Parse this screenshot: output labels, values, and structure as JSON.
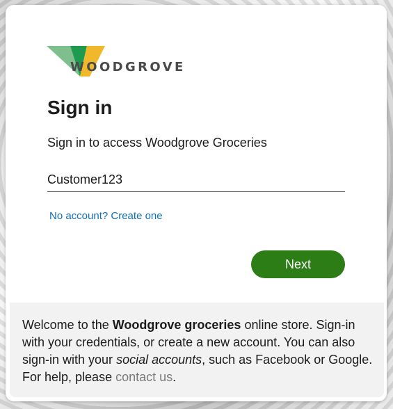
{
  "brand": {
    "name": "WOODGROVE",
    "colors": {
      "light_green": "#8cc63f",
      "dark_green": "#1e9b4f",
      "yellow": "#f2b82b",
      "sage": "#7fbf8e"
    }
  },
  "signin": {
    "title": "Sign in",
    "subtitle": "Sign in to access Woodgrove Groceries",
    "username_value": "Customer123",
    "create_link": "No account? Create one",
    "next_label": "Next"
  },
  "footer": {
    "part1": "Welcome to the ",
    "bold": "Woodgrove groceries",
    "part2": " online store. Sign-in with your credentials, or create a new account. You can also sign-in with your ",
    "italic": "social accounts",
    "part3": ", such as Facebook or Google. For help, please ",
    "link": "contact us",
    "part4": "."
  },
  "theme": {
    "accent": "#2c7d16",
    "link": "#0f6cbd"
  }
}
